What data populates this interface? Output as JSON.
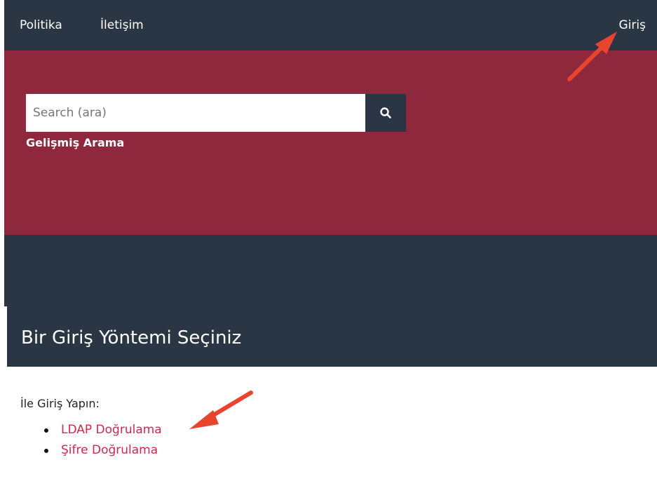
{
  "nav": {
    "politika": "Politika",
    "iletisim": "İletişim",
    "giris": "Giriş"
  },
  "search": {
    "placeholder": "Search (ara)",
    "button_icon": "search-icon",
    "advanced": "Gelişmiş Arama"
  },
  "page": {
    "title": "Bir Giriş Yöntemi Seçiniz",
    "intro": "İle Giriş Yapın:",
    "methods": [
      "LDAP Doğrulama",
      "Şifre Doğrulama"
    ]
  },
  "colors": {
    "nav_bg": "#2b3644",
    "hero_bg": "#8f283c",
    "link": "#d0284d",
    "arrow": "#e8442e"
  }
}
